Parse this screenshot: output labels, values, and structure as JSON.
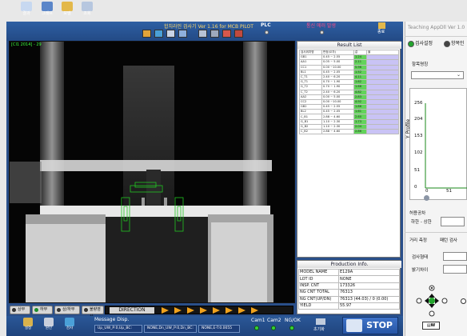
{
  "toolbar": {
    "items": [
      {
        "label": "결과",
        "icon": "camera-icon"
      },
      {
        "label": "그래프",
        "icon": "graph-icon"
      },
      {
        "label": "모델",
        "icon": "model-icon"
      },
      {
        "label": "조회",
        "icon": "search-icon"
      }
    ],
    "title": "합치라인 검사기 Ver 1.16 for MCB PILOT",
    "plc": "PLC",
    "alarm": "통신 에러 발생",
    "exit": "종료"
  },
  "viewport": {
    "status": "[CI1 2014] - 29"
  },
  "result_list": {
    "title": "Result List",
    "headers": [
      "검사위치명",
      "판정(오차)",
      "값",
      "율"
    ],
    "rows": [
      {
        "name": "GB1",
        "range": "0.45 ~ 2.55",
        "value": "1.24"
      },
      {
        "name": "AA1",
        "range": "0.05 ~ 5.00",
        "value": "2.11"
      },
      {
        "name": "CC1",
        "range": "0.00 ~10.00",
        "value": "5.96"
      },
      {
        "name": "BL1",
        "range": "0.45 ~ 2.05",
        "value": "1.52"
      },
      {
        "name": "C_T1",
        "range": "2.40 ~ 6.20",
        "value": "4.11"
      },
      {
        "name": "G_T1",
        "range": "0.70 ~ 1.90",
        "value": "1.62"
      },
      {
        "name": "G_T2",
        "range": "0.70 ~ 1.90",
        "value": "1.68"
      },
      {
        "name": "C_T2",
        "range": "2.40 ~ 6.20",
        "value": "4.82"
      },
      {
        "name": "AA2",
        "range": "0.00 ~ 5.00",
        "value": "2.83"
      },
      {
        "name": "CC2",
        "range": "0.00 ~10.00",
        "value": "4.92"
      },
      {
        "name": "GB2",
        "range": "0.45 ~ 2.55",
        "value": "1.86"
      },
      {
        "name": "BL2",
        "range": "0.45 ~ 2.05",
        "value": "1.61"
      },
      {
        "name": "C_B1",
        "range": "2.88 ~ 4.60",
        "value": "2.60"
      },
      {
        "name": "G_B1",
        "range": "1.10 ~ 2.30",
        "value": "1.73"
      },
      {
        "name": "G_B2",
        "range": "1.10 ~ 2.30",
        "value": "2.04"
      },
      {
        "name": "C_B2",
        "range": "2.88 ~ 4.60",
        "value": "2.86"
      }
    ]
  },
  "production": {
    "title": "Production Info.",
    "rows": [
      {
        "label": "MODEL NAME",
        "value": "E129A"
      },
      {
        "label": "LOT ID",
        "value": "NONE"
      },
      {
        "label": "INSP. CNT",
        "value": "173326"
      },
      {
        "label": "NG CNT TOTAL",
        "value": "76313"
      },
      {
        "label": "NG CNT(UP/DN)",
        "value": "76313 (44.03) / 0 (0.00)"
      },
      {
        "label": "YIELD",
        "value": "55.97"
      }
    ]
  },
  "bottom_radios": [
    {
      "label": "상부",
      "on": false
    },
    {
      "label": "하부",
      "on": true
    },
    {
      "label": "상/하부",
      "on": false
    },
    {
      "label": "불량영상",
      "on": false
    }
  ],
  "direction": {
    "label": "DIRECTION",
    "arrows": 8
  },
  "bottombar": {
    "items": [
      {
        "label": "설정",
        "icon": "settings-icon"
      },
      {
        "label": "원인",
        "icon": "cause-icon"
      },
      {
        "label": "검사",
        "icon": "inspect-icon"
      }
    ],
    "message_title": "Message Disp.",
    "messages": [
      "Up_UW_P:0,Up_BC:",
      "NONE,Dn_UW_P:0,Dn_BC:",
      "NONE,E-T:0.0055"
    ],
    "cam1": "Cam1",
    "cam2": "Cam2",
    "ngok": "NG/OK",
    "init_label": "초기화",
    "stop": "STOP"
  },
  "side_panel": {
    "title": "Teaching AppDll Ver 1.0",
    "tabs": [
      {
        "label": "검사설정",
        "state": "on"
      },
      {
        "label": "항목인",
        "state": "off"
      }
    ],
    "item_label": "항목명칭",
    "y_axis_label": "Y Profile",
    "y_ticks": [
      "256",
      "204",
      "153",
      "102",
      "51",
      "0"
    ],
    "x_ticks": [
      "0",
      "51"
    ],
    "tolerance_label": "허용공차",
    "tolerance_range": "하한 - 상한",
    "dist_label": "거리 측정",
    "pattern_label": "패턴 검사",
    "threshold_label": "검사형태",
    "brightness_label": "밝기차이",
    "step_label": "▤W"
  },
  "colors": {
    "app_bg": "#2a4f8a",
    "result_ok": "#62d35a",
    "arrow": "#f0a21c",
    "status_green": "#3cff3c",
    "overlay_green": "#22c522"
  }
}
